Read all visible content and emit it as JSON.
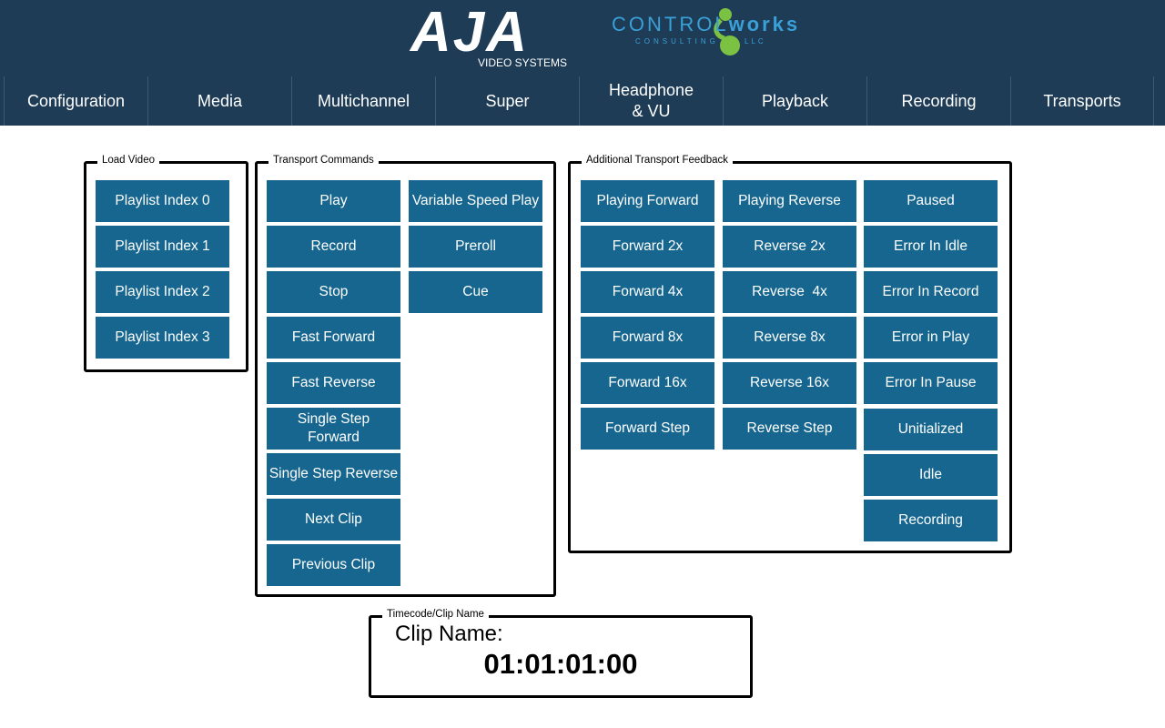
{
  "header": {
    "aja_logo_text": "AJA",
    "aja_logo_subtitle": "VIDEO SYSTEMS",
    "cw_logo_control": "CONTROL",
    "cw_logo_works": "works",
    "cw_logo_consulting": "CONSULTING",
    "cw_logo_llc": "LLC"
  },
  "nav": {
    "items": [
      "Configuration",
      "Media",
      "Multichannel",
      "Super",
      "Headphone\n& VU",
      "Playback",
      "Recording",
      "Transports"
    ]
  },
  "load_video": {
    "label": "Load Video",
    "buttons": [
      "Playlist Index 0",
      "Playlist Index 1",
      "Playlist Index 2",
      "Playlist Index 3"
    ]
  },
  "transport_commands": {
    "label": "Transport Commands",
    "col1": [
      "Play",
      "Record",
      "Stop",
      "Fast Forward",
      "Fast Reverse",
      "Single Step Forward",
      "Single Step Reverse",
      "Next Clip",
      "Previous Clip"
    ],
    "col2": [
      "Variable Speed Play",
      "Preroll",
      "Cue"
    ]
  },
  "feedback": {
    "label": "Additional Transport Feedback",
    "col1": [
      "Playing Forward",
      "Forward 2x",
      "Forward 4x",
      "Forward 8x",
      "Forward 16x",
      "Forward Step"
    ],
    "col2": [
      "Playing Reverse",
      "Reverse 2x",
      "Reverse  4x",
      "Reverse 8x",
      "Reverse 16x",
      "Reverse Step"
    ],
    "col3": [
      "Paused",
      "Error In Idle",
      "Error In Record",
      "Error in Play",
      "Error In Pause",
      "Unitialized",
      "Idle",
      "Recording"
    ]
  },
  "timecode": {
    "label": "Timecode/Clip Name",
    "clip_name_label": "Clip Name:",
    "value": "01:01:01:00"
  },
  "colors": {
    "header_bg": "#1e3c56",
    "button_bg": "#16668f",
    "button_text": "#ffffff"
  }
}
